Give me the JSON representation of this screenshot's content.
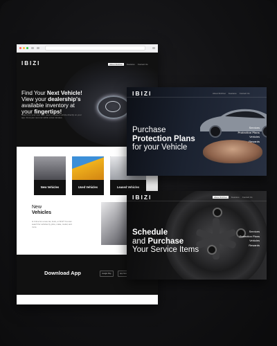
{
  "brand": "IBIZI",
  "nav": {
    "items": [
      "About IbiziCar",
      "Features",
      "Contact Us"
    ]
  },
  "hero": {
    "line1": "Find Your ",
    "line1_bold": "Next Vehicle!",
    "line2": "View your ",
    "line2_bold": "dealership's",
    "line3": "available inventory at",
    "line4": "your ",
    "line4_bold": "fingertips!",
    "sub": "Search for your next new, used, or leased vehicle directly on your app. Find your next car within a few minutes."
  },
  "cards": [
    {
      "label": "New Vehicles",
      "color": "#7f7f85"
    },
    {
      "label": "Used Vehicles",
      "color": "#e6a21a"
    },
    {
      "label": "Leased Vehicles",
      "color": "#c8c9cc"
    }
  ],
  "new_section": {
    "title1": "New",
    "title2": "Vehicles",
    "desc": "Is it time for a new car, truck, or SUV? You can search for vehicles by price, make, model, and more."
  },
  "download": {
    "title": "Download App",
    "google": "Google Play",
    "apple": "App Store"
  },
  "panel1": {
    "line1": "Purchase",
    "line2": "Protection Plans",
    "line3": "for your Vehicle",
    "menu": [
      "Services",
      "Protection Plans",
      "Vehicles",
      "Rewards"
    ]
  },
  "panel2": {
    "line1": "Schedule",
    "line2a": "and ",
    "line2b": "Purchase",
    "line3": "Your Service Items",
    "menu": [
      "Services",
      "Protection Plans",
      "Vehicles",
      "Rewards"
    ]
  },
  "colors": {
    "bg": "#121214",
    "accent": "#ffffff"
  }
}
